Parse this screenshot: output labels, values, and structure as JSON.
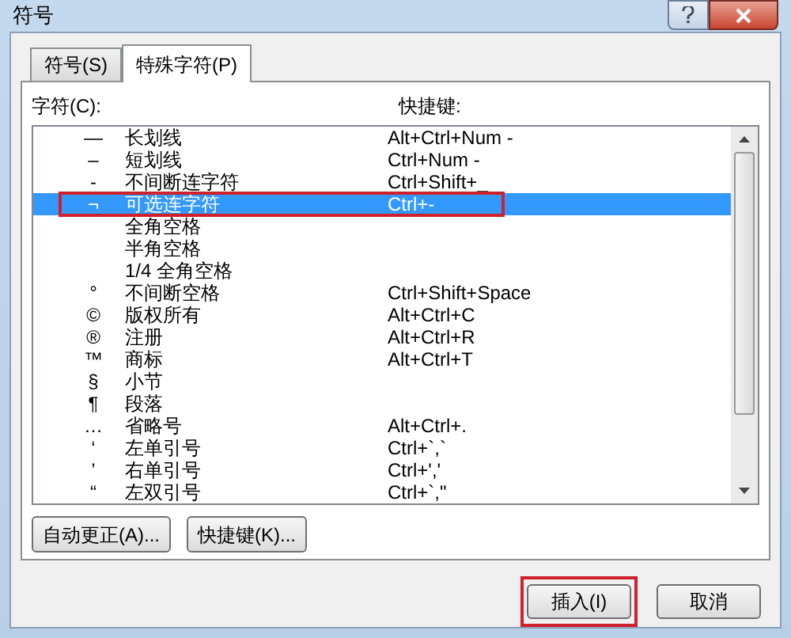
{
  "window": {
    "title": "符号"
  },
  "tabs": [
    {
      "label": "符号(S)",
      "selected": false
    },
    {
      "label": "特殊字符(P)",
      "selected": true
    }
  ],
  "list": {
    "label": "字符(C):",
    "shortcut_label": "快捷键:",
    "rows": [
      {
        "symbol": "—",
        "name": "长划线",
        "shortcut": "Alt+Ctrl+Num -",
        "selected": false,
        "highlighted": false
      },
      {
        "symbol": "–",
        "name": "短划线",
        "shortcut": "Ctrl+Num -",
        "selected": false,
        "highlighted": false
      },
      {
        "symbol": "-",
        "name": "不间断连字符",
        "shortcut": "Ctrl+Shift+_",
        "selected": false,
        "highlighted": false
      },
      {
        "symbol": "¬",
        "name": "可选连字符",
        "shortcut": "Ctrl+-",
        "selected": true,
        "highlighted": true
      },
      {
        "name": "全角空格",
        "selected": false,
        "highlighted": false
      },
      {
        "name": "半角空格",
        "selected": false,
        "highlighted": false
      },
      {
        "name": "1/4 全角空格",
        "selected": false,
        "highlighted": false
      },
      {
        "symbol": "°",
        "name": "不间断空格",
        "shortcut": "Ctrl+Shift+Space",
        "selected": false,
        "highlighted": false
      },
      {
        "symbol": "©",
        "name": "版权所有",
        "shortcut": "Alt+Ctrl+C",
        "selected": false,
        "highlighted": false
      },
      {
        "symbol": "®",
        "name": "注册",
        "shortcut": "Alt+Ctrl+R",
        "selected": false,
        "highlighted": false
      },
      {
        "symbol": "™",
        "name": "商标",
        "shortcut": "Alt+Ctrl+T",
        "selected": false,
        "highlighted": false
      },
      {
        "symbol": "§",
        "name": "小节",
        "selected": false,
        "highlighted": false
      },
      {
        "symbol": "¶",
        "name": "段落",
        "selected": false,
        "highlighted": false
      },
      {
        "symbol": "…",
        "name": "省略号",
        "shortcut": "Alt+Ctrl+.",
        "selected": false,
        "highlighted": false
      },
      {
        "symbol": "‘",
        "name": "左单引号",
        "shortcut": "Ctrl+`,`",
        "selected": false,
        "highlighted": false
      },
      {
        "symbol": "’",
        "name": "右单引号",
        "shortcut": "Ctrl+','",
        "selected": false,
        "highlighted": false
      },
      {
        "symbol": "“",
        "name": "左双引号",
        "shortcut": "Ctrl+`,\"",
        "selected": false,
        "highlighted": false
      }
    ]
  },
  "panel_buttons": [
    "自动更正(A)...",
    "快捷键(K)..."
  ],
  "dialog_buttons": [
    {
      "label": "插入(I)",
      "highlighted": true
    },
    {
      "label": "取消",
      "highlighted": false
    }
  ]
}
